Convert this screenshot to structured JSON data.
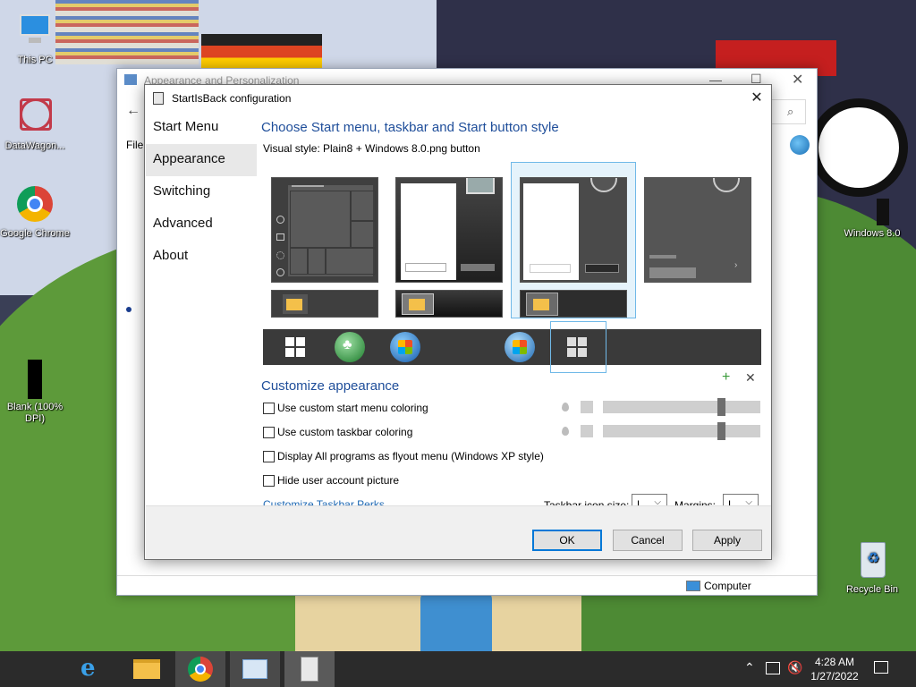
{
  "desktop": {
    "icons": [
      {
        "label": "This PC"
      },
      {
        "label": "DataWagon..."
      },
      {
        "label": "Google Chrome"
      },
      {
        "label": "Blank (100% DPI)"
      },
      {
        "label": "Windows 8.0"
      },
      {
        "label": "Recycle Bin"
      }
    ]
  },
  "explorer": {
    "title": "Appearance and Personalization",
    "menu_file": "File",
    "status_computer": "Computer"
  },
  "dialog": {
    "title": "StartIsBack configuration",
    "nav": [
      "Start Menu",
      "Appearance",
      "Switching",
      "Advanced",
      "About"
    ],
    "heading": "Choose Start menu, taskbar and Start button style",
    "visual_style_label": "Visual style:",
    "visual_style_value": "Plain8 + Windows 8.0.png button",
    "customize_heading": "Customize appearance",
    "checkboxes": [
      "Use custom start menu coloring",
      "Use custom taskbar coloring",
      "Display All programs as flyout menu (Windows XP style)",
      "Hide user account picture"
    ],
    "link": "Customize Taskbar Perks...",
    "icon_size_label": "Taskbar icon size:",
    "icon_size_value": "L",
    "margins_label": "Margins:",
    "margins_value": "L",
    "buttons": {
      "ok": "OK",
      "cancel": "Cancel",
      "apply": "Apply"
    },
    "selected_style_index": 2,
    "selected_orb_index": 4
  },
  "taskbar": {
    "time": "4:28 AM",
    "date": "1/27/2022"
  },
  "colors": {
    "accent": "#0078d7",
    "heading_blue": "#1f4e9a",
    "link_blue": "#1d68b4",
    "selection_border": "#70b9e8",
    "taskbar": "#2b2b2b"
  }
}
